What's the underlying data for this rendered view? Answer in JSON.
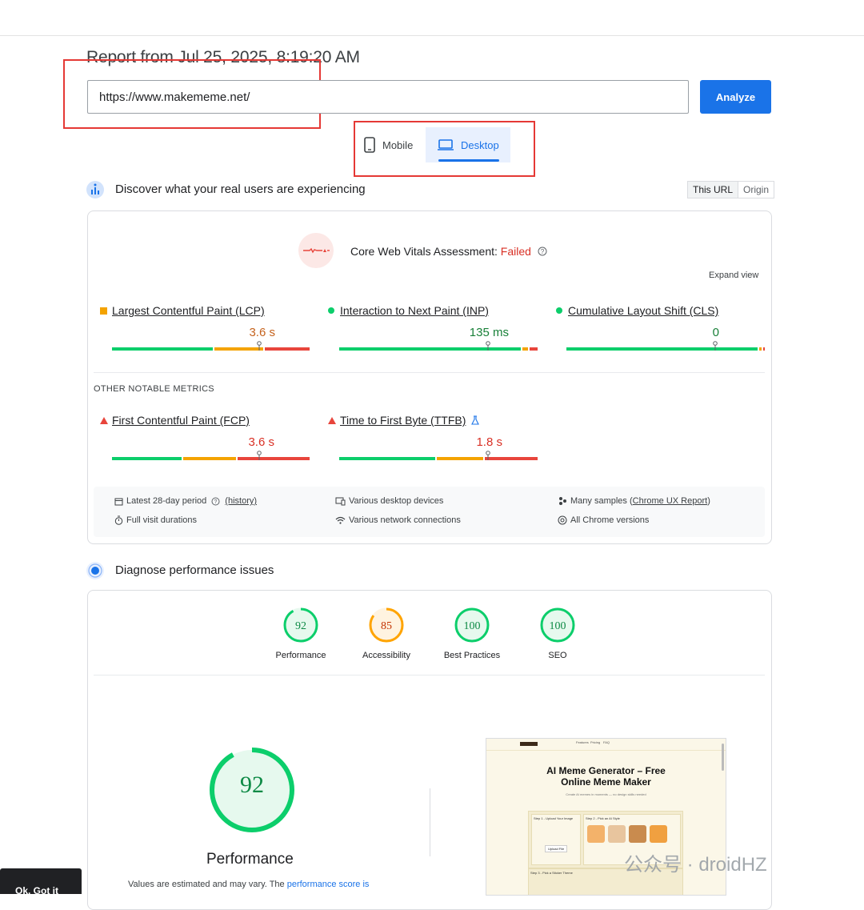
{
  "report_title": "Report from Jul 25, 2025, 8:19:20 AM",
  "url_input": {
    "value": "https://www.makememe.net/"
  },
  "analyze_label": "Analyze",
  "device_tabs": {
    "mobile": "Mobile",
    "desktop": "Desktop",
    "selected": "Desktop"
  },
  "field": {
    "title": "Discover what your real users are experiencing",
    "toggle": {
      "this_url": "This URL",
      "origin": "Origin"
    },
    "cwv_prefix": "Core Web Vitals Assessment: ",
    "cwv_status": "Failed",
    "expand_label": "Expand view",
    "metrics": [
      {
        "name": "Largest Contentful Paint (LCP)",
        "value": "3.6 s",
        "status": "orange"
      },
      {
        "name": "Interaction to Next Paint (INP)",
        "value": "135 ms",
        "status": "green"
      },
      {
        "name": "Cumulative Layout Shift (CLS)",
        "value": "0",
        "status": "green"
      }
    ],
    "other_label": "OTHER NOTABLE METRICS",
    "other_metrics": [
      {
        "name": "First Contentful Paint (FCP)",
        "value": "3.6 s",
        "status": "red"
      },
      {
        "name": "Time to First Byte (TTFB)",
        "value": "1.8 s",
        "status": "red"
      }
    ],
    "info": {
      "period": "Latest 28-day period",
      "history": "(history)",
      "durations": "Full visit durations",
      "devices": "Various desktop devices",
      "network": "Various network connections",
      "samples_prefix": "Many samples (",
      "samples_link": "Chrome UX Report",
      "samples_suffix": ")",
      "versions": "All Chrome versions"
    }
  },
  "lab": {
    "title": "Diagnose performance issues",
    "scores": [
      {
        "label": "Performance",
        "score": "92",
        "color": "#0cce6b"
      },
      {
        "label": "Accessibility",
        "score": "85",
        "color": "#ffa400"
      },
      {
        "label": "Best Practices",
        "score": "100",
        "color": "#0cce6b"
      },
      {
        "label": "SEO",
        "score": "100",
        "color": "#0cce6b"
      }
    ],
    "big_score": "92",
    "big_label": "Performance",
    "values_prefix": "Values are estimated and may vary. The ",
    "values_link": "performance score is"
  },
  "thumbnail": {
    "title_line1": "AI Meme Generator – Free",
    "title_line2": "Online Meme Maker",
    "subtitle": "Create AI memes in moments — no design skills needed",
    "step1": "Step 1 - Upload Your Image",
    "step2": "Step 2 - Pick an AI Style",
    "step3": "Step 3 - Pick a Sticker Theme",
    "upload_btn": "Upload File",
    "nav": [
      "Features",
      "Pricing",
      "FAQ"
    ]
  },
  "toast_label": "Ok, Got it",
  "watermark": "公众号 · droidHZ",
  "colors": {
    "accent": "#1a73e8",
    "fail": "#d93025",
    "good": "#0cce6b",
    "average": "#ffa400"
  }
}
